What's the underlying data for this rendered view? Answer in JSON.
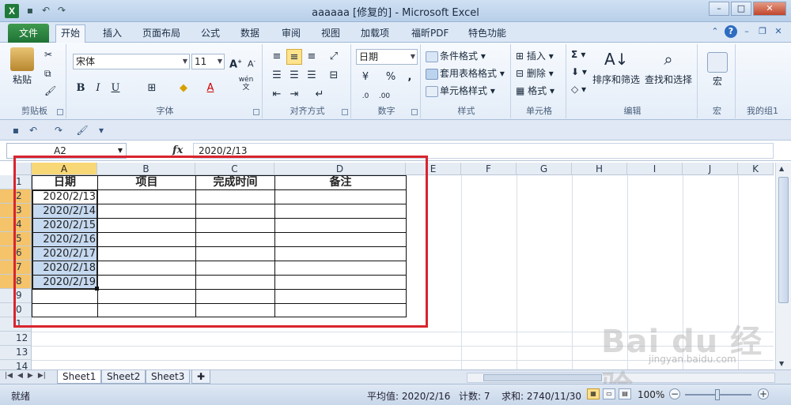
{
  "window": {
    "title": "aaaaaa [修复的] - Microsoft Excel"
  },
  "ribbon_tabs": {
    "file": "文件",
    "items": [
      "开始",
      "插入",
      "页面布局",
      "公式",
      "数据",
      "审阅",
      "视图",
      "加载项",
      "福昕PDF",
      "特色功能"
    ]
  },
  "clipboard": {
    "paste": "粘贴",
    "label": "剪贴板"
  },
  "font": {
    "name": "宋体",
    "size": "11",
    "bold": "B",
    "italic": "I",
    "underline": "U",
    "label": "字体",
    "wen": "wén"
  },
  "alignment": {
    "label": "对齐方式"
  },
  "number": {
    "format": "日期",
    "percent": "%",
    "comma": ",",
    "label": "数字"
  },
  "styles": {
    "conditional": "条件格式",
    "table": "套用表格格式",
    "cell_styles": "单元格样式",
    "label": "样式"
  },
  "cells": {
    "insert": "插入",
    "delete": "删除",
    "format": "格式",
    "label": "单元格"
  },
  "editing": {
    "sort_filter": "排序和筛选",
    "find_select": "查找和选择",
    "label": "编辑"
  },
  "macros": {
    "macro": "宏",
    "label": "宏"
  },
  "mygroup": {
    "label": "我的组1"
  },
  "formula_bar": {
    "name_box": "A2",
    "fx": "fx",
    "value": "2020/2/13"
  },
  "columns": [
    "A",
    "B",
    "C",
    "D",
    "E",
    "F",
    "G",
    "H",
    "I",
    "J",
    "K"
  ],
  "rows": [
    "1",
    "2",
    "3",
    "4",
    "5",
    "6",
    "7",
    "8",
    "9",
    "0",
    "1",
    "12",
    "13",
    "14"
  ],
  "table": {
    "headers": [
      "日期",
      "项目",
      "完成时间",
      "备注"
    ],
    "dates": [
      "2020/2/13",
      "2020/2/14",
      "2020/2/15",
      "2020/2/16",
      "2020/2/17",
      "2020/2/18",
      "2020/2/19"
    ]
  },
  "sheets": [
    "Sheet1",
    "Sheet2",
    "Sheet3"
  ],
  "status": {
    "ready": "就绪",
    "average": "平均值: 2020/2/16",
    "count": "计数: 7",
    "sum": "求和: 2740/11/30",
    "zoom": "100%"
  },
  "watermark": {
    "text": "Bai du 经验",
    "url": "jingyan.baidu.com"
  },
  "colors": {
    "accent_green": "#1e7235",
    "selection_header": "#f8d776",
    "red_box": "#d9242e"
  }
}
